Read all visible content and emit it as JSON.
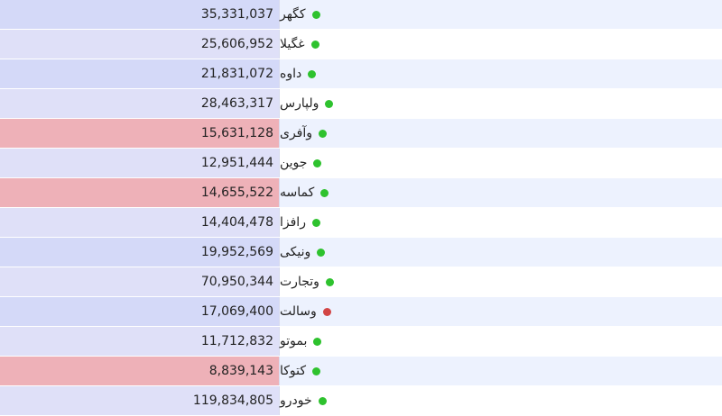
{
  "colors": {
    "row_alt_value": "#dfe0f8",
    "row_alt_value_2": "#d4d9f8",
    "row_alt_name": "#edf2fe",
    "row_name_plain": "#ffffff",
    "highlight_red": "#eeb1b8",
    "status_green": "#2ec22e",
    "status_red": "#d24545"
  },
  "rows": [
    {
      "name": "کگهر",
      "value": "35,331,037",
      "status": "green",
      "highlight": false
    },
    {
      "name": "غگیلا",
      "value": "25,606,952",
      "status": "green",
      "highlight": false
    },
    {
      "name": "داوه",
      "value": "21,831,072",
      "status": "green",
      "highlight": false
    },
    {
      "name": "ولپارس",
      "value": "28,463,317",
      "status": "green",
      "highlight": false
    },
    {
      "name": "وآفری",
      "value": "15,631,128",
      "status": "green",
      "highlight": true
    },
    {
      "name": "جوین",
      "value": "12,951,444",
      "status": "green",
      "highlight": false
    },
    {
      "name": "کماسه",
      "value": "14,655,522",
      "status": "green",
      "highlight": true
    },
    {
      "name": "رافزا",
      "value": "14,404,478",
      "status": "green",
      "highlight": false
    },
    {
      "name": "ونیکی",
      "value": "19,952,569",
      "status": "green",
      "highlight": false
    },
    {
      "name": "وتجارت",
      "value": "70,950,344",
      "status": "green",
      "highlight": false
    },
    {
      "name": "وسالت",
      "value": "17,069,400",
      "status": "red",
      "highlight": false
    },
    {
      "name": "بموتو",
      "value": "11,712,832",
      "status": "green",
      "highlight": false
    },
    {
      "name": "کتوکا",
      "value": "8,839,143",
      "status": "green",
      "highlight": true
    },
    {
      "name": "خودرو",
      "value": "119,834,805",
      "status": "green",
      "highlight": false
    }
  ]
}
